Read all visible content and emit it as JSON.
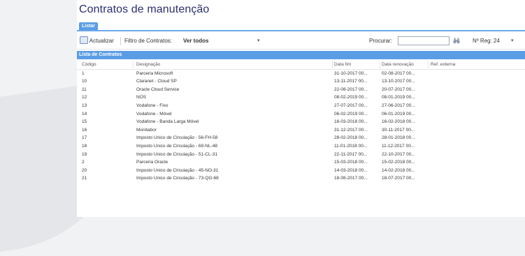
{
  "page": {
    "title": "Contratos de manutenção"
  },
  "tabs": [
    {
      "label": "Listar"
    }
  ],
  "toolbar": {
    "refresh_label": "Actualizar",
    "filter_label": "Filtro de Contratos:",
    "filter_value": "Ver todos",
    "search_label": "Procurar:",
    "search_value": "",
    "records_label": "Nº Reg: 24"
  },
  "panel": {
    "title": "Lista de Contratos"
  },
  "table": {
    "columns": [
      "Código",
      "Designação",
      "Data fim",
      "Data renovação",
      "Ref. externa"
    ],
    "rows": [
      [
        "1",
        "Parceria Microsoft",
        "31-10-2017 00...",
        "02-08-2017 00...",
        ""
      ],
      [
        "10",
        "Claranet - Cloud SP",
        "13-11-2017 00...",
        "13-10-2017 00...",
        ""
      ],
      [
        "11",
        "Oracle Cloud Service",
        "22-08-2017 00...",
        "20-07-2017 00...",
        ""
      ],
      [
        "12",
        "NOS",
        "08-02-2019 00...",
        "08-01-2019 00...",
        ""
      ],
      [
        "13",
        "Vodafone - Fixo",
        "27-07-2017 00...",
        "27-06-2017 00...",
        ""
      ],
      [
        "14",
        "Vodafone - Móvel",
        "06-02-2019 00...",
        "06-01-2019 00...",
        ""
      ],
      [
        "15",
        "Vodafone - Banda Larga Móvel",
        "16-03-2018 00...",
        "16-02-2018 00...",
        ""
      ],
      [
        "16",
        "Monitabor",
        "31-12-2017 00...",
        "30-11-2017 00...",
        ""
      ],
      [
        "17",
        "Imposto Unico de Circulação - 56-FH-58",
        "28-02-2018 00...",
        "28-01-2018 00...",
        ""
      ],
      [
        "18",
        "Imposto Unico de Circulação - 69-NL-48",
        "11-01-2018 00...",
        "11-12-2017 00...",
        ""
      ],
      [
        "19",
        "Imposto Unico de Circulação - 51-CL-31",
        "22-11-2017 00...",
        "22-10-2017 00...",
        ""
      ],
      [
        "2",
        "Parceria Oracle",
        "15-03-2018 00...",
        "15-02-2018 00...",
        ""
      ],
      [
        "20",
        "Imposto Unico de Circulação - 45-NO-31",
        "14-03-2018 00...",
        "14-02-2018 00...",
        ""
      ],
      [
        "21",
        "Imposto Unico de Circulação - 73-QG-68",
        "18-08-2017 00...",
        "18-07-2017 00...",
        ""
      ]
    ]
  }
}
